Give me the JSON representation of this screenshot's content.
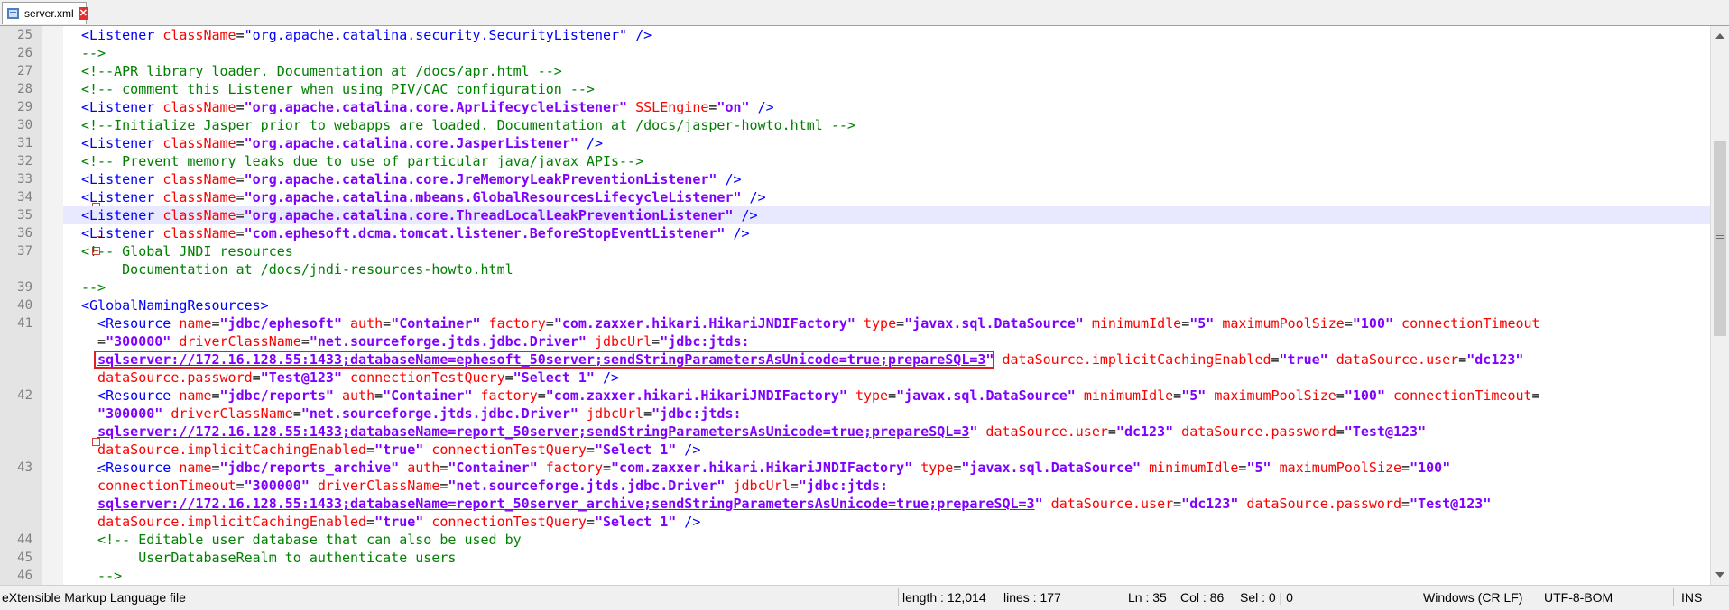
{
  "tab": {
    "label": "server.xml",
    "file_icon": "xml-file-icon",
    "close_icon": "close-icon"
  },
  "lines": [
    {
      "num": "25",
      "tokens": [
        [
          "t",
          "<Listener "
        ],
        [
          "a",
          "className"
        ],
        [
          "p",
          "="
        ],
        [
          "t",
          "\"org.apache.catalina.security.SecurityListener\" />"
        ]
      ]
    },
    {
      "num": "26",
      "tokens": [
        [
          "c",
          "-->"
        ]
      ]
    },
    {
      "num": "27",
      "tokens": [
        [
          "c",
          "<!--APR library loader. Documentation at /docs/apr.html -->"
        ]
      ]
    },
    {
      "num": "28",
      "tokens": [
        [
          "c",
          "<!-- comment this Listener when using PIV/CAC configuration -->"
        ]
      ]
    },
    {
      "num": "29",
      "tokens": [
        [
          "t",
          "<Listener "
        ],
        [
          "a",
          "className"
        ],
        [
          "p",
          "="
        ],
        [
          "v",
          "\"org.apache.catalina.core.AprLifecycleListener\""
        ],
        [
          "a",
          " SSLEngine"
        ],
        [
          "p",
          "="
        ],
        [
          "v",
          "\"on\""
        ],
        [
          "t",
          " />"
        ]
      ]
    },
    {
      "num": "30",
      "tokens": [
        [
          "c",
          "<!--Initialize Jasper prior to webapps are loaded. Documentation at /docs/jasper-howto.html -->"
        ]
      ]
    },
    {
      "num": "31",
      "tokens": [
        [
          "t",
          "<Listener "
        ],
        [
          "a",
          "className"
        ],
        [
          "p",
          "="
        ],
        [
          "v",
          "\"org.apache.catalina.core.JasperListener\""
        ],
        [
          "t",
          " />"
        ]
      ]
    },
    {
      "num": "32",
      "tokens": [
        [
          "c",
          "<!-- Prevent memory leaks due to use of particular java/javax APIs-->"
        ]
      ]
    },
    {
      "num": "33",
      "tokens": [
        [
          "t",
          "<Listener "
        ],
        [
          "a",
          "className"
        ],
        [
          "p",
          "="
        ],
        [
          "v",
          "\"org.apache.catalina.core.JreMemoryLeakPreventionListener\""
        ],
        [
          "t",
          " />"
        ]
      ]
    },
    {
      "num": "34",
      "tokens": [
        [
          "t",
          "<Listener "
        ],
        [
          "a",
          "className"
        ],
        [
          "p",
          "="
        ],
        [
          "v",
          "\"org.apache.catalina.mbeans.GlobalResourcesLifecycleListener\""
        ],
        [
          "t",
          " />"
        ]
      ]
    },
    {
      "num": "35",
      "current": true,
      "tokens": [
        [
          "t",
          "<Listener "
        ],
        [
          "a",
          "className"
        ],
        [
          "p",
          "="
        ],
        [
          "v",
          "\"org.apache.catalina.core.ThreadLocalLeakPreventionListener\""
        ],
        [
          "t",
          " />"
        ]
      ]
    },
    {
      "num": "36",
      "tokens": [
        [
          "t",
          "<Listener "
        ],
        [
          "a",
          "className"
        ],
        [
          "p",
          "="
        ],
        [
          "v",
          "\"com.ephesoft.dcma.tomcat.listener.BeforeStopEventListener\""
        ],
        [
          "t",
          " />"
        ]
      ]
    },
    {
      "num": "37",
      "tokens": [
        [
          "c",
          "<!-- Global JNDI resources"
        ]
      ]
    },
    {
      "num": "",
      "tokens": [
        [
          "c",
          "     Documentation at /docs/jndi-resources-howto.html"
        ]
      ]
    },
    {
      "num": "39",
      "tokens": [
        [
          "c",
          "-->"
        ]
      ]
    },
    {
      "num": "40",
      "tokens": [
        [
          "t",
          "<GlobalNamingResources>"
        ]
      ]
    },
    {
      "num": "41",
      "tokens": [
        [
          "t",
          "  <Resource "
        ],
        [
          "a",
          "name"
        ],
        [
          "p",
          "="
        ],
        [
          "v",
          "\"jdbc/ephesoft\""
        ],
        [
          "a",
          " auth"
        ],
        [
          "p",
          "="
        ],
        [
          "v",
          "\"Container\""
        ],
        [
          "a",
          " factory"
        ],
        [
          "p",
          "="
        ],
        [
          "v",
          "\"com.zaxxer.hikari.HikariJNDIFactory\""
        ],
        [
          "a",
          " type"
        ],
        [
          "p",
          "="
        ],
        [
          "v",
          "\"javax.sql.DataSource\""
        ],
        [
          "a",
          " minimumIdle"
        ],
        [
          "p",
          "="
        ],
        [
          "v",
          "\"5\""
        ],
        [
          "a",
          " maximumPoolSize"
        ],
        [
          "p",
          "="
        ],
        [
          "v",
          "\"100\""
        ],
        [
          "a",
          " connectionTimeout"
        ]
      ]
    },
    {
      "num": "",
      "tokens": [
        [
          "p",
          "  ="
        ],
        [
          "v",
          "\"300000\""
        ],
        [
          "a",
          " driverClassName"
        ],
        [
          "p",
          "="
        ],
        [
          "v",
          "\"net.sourceforge.jtds.jdbc.Driver\""
        ],
        [
          "a",
          " jdbcUrl"
        ],
        [
          "p",
          "="
        ],
        [
          "v",
          "\"jdbc:jtds:"
        ]
      ]
    },
    {
      "num": "",
      "boxed": true,
      "tokens": [
        [
          "p",
          "  "
        ],
        [
          "u",
          "sqlserver://172.16.128.55:1433;databaseName=ephesoft_50server;sendStringParametersAsUnicode=true;prepareSQL=3"
        ],
        [
          "v",
          "\""
        ],
        [
          "a",
          " dataSource.implicitCachingEnabled"
        ],
        [
          "p",
          "="
        ],
        [
          "v",
          "\"true\""
        ],
        [
          "a",
          " dataSource.user"
        ],
        [
          "p",
          "="
        ],
        [
          "v",
          "\"dc123\""
        ]
      ]
    },
    {
      "num": "",
      "tokens": [
        [
          "a",
          "  dataSource.password"
        ],
        [
          "p",
          "="
        ],
        [
          "v",
          "\"Test@123\""
        ],
        [
          "a",
          " connectionTestQuery"
        ],
        [
          "p",
          "="
        ],
        [
          "v",
          "\"Select 1\""
        ],
        [
          "t",
          " />"
        ]
      ]
    },
    {
      "num": "42",
      "tokens": [
        [
          "t",
          "  <Resource "
        ],
        [
          "a",
          "name"
        ],
        [
          "p",
          "="
        ],
        [
          "v",
          "\"jdbc/reports\""
        ],
        [
          "a",
          " auth"
        ],
        [
          "p",
          "="
        ],
        [
          "v",
          "\"Container\""
        ],
        [
          "a",
          " factory"
        ],
        [
          "p",
          "="
        ],
        [
          "v",
          "\"com.zaxxer.hikari.HikariJNDIFactory\""
        ],
        [
          "a",
          " type"
        ],
        [
          "p",
          "="
        ],
        [
          "v",
          "\"javax.sql.DataSource\""
        ],
        [
          "a",
          " minimumIdle"
        ],
        [
          "p",
          "="
        ],
        [
          "v",
          "\"5\""
        ],
        [
          "a",
          " maximumPoolSize"
        ],
        [
          "p",
          "="
        ],
        [
          "v",
          "\"100\""
        ],
        [
          "a",
          " connectionTimeout"
        ],
        [
          "p",
          "="
        ]
      ]
    },
    {
      "num": "",
      "tokens": [
        [
          "v",
          "  \"300000\""
        ],
        [
          "a",
          " driverClassName"
        ],
        [
          "p",
          "="
        ],
        [
          "v",
          "\"net.sourceforge.jtds.jdbc.Driver\""
        ],
        [
          "a",
          " jdbcUrl"
        ],
        [
          "p",
          "="
        ],
        [
          "v",
          "\"jdbc:jtds:"
        ]
      ]
    },
    {
      "num": "",
      "tokens": [
        [
          "p",
          "  "
        ],
        [
          "u",
          "sqlserver://172.16.128.55:1433;databaseName=report_50server;sendStringParametersAsUnicode=true;prepareSQL=3"
        ],
        [
          "v",
          "\""
        ],
        [
          "a",
          " dataSource.user"
        ],
        [
          "p",
          "="
        ],
        [
          "v",
          "\"dc123\""
        ],
        [
          "a",
          " dataSource.password"
        ],
        [
          "p",
          "="
        ],
        [
          "v",
          "\"Test@123\""
        ]
      ]
    },
    {
      "num": "",
      "tokens": [
        [
          "a",
          "  dataSource.implicitCachingEnabled"
        ],
        [
          "p",
          "="
        ],
        [
          "v",
          "\"true\""
        ],
        [
          "a",
          " connectionTestQuery"
        ],
        [
          "p",
          "="
        ],
        [
          "v",
          "\"Select 1\""
        ],
        [
          "t",
          " />"
        ]
      ]
    },
    {
      "num": "43",
      "tokens": [
        [
          "t",
          "  <Resource "
        ],
        [
          "a",
          "name"
        ],
        [
          "p",
          "="
        ],
        [
          "v",
          "\"jdbc/reports_archive\""
        ],
        [
          "a",
          " auth"
        ],
        [
          "p",
          "="
        ],
        [
          "v",
          "\"Container\""
        ],
        [
          "a",
          " factory"
        ],
        [
          "p",
          "="
        ],
        [
          "v",
          "\"com.zaxxer.hikari.HikariJNDIFactory\""
        ],
        [
          "a",
          " type"
        ],
        [
          "p",
          "="
        ],
        [
          "v",
          "\"javax.sql.DataSource\""
        ],
        [
          "a",
          " minimumIdle"
        ],
        [
          "p",
          "="
        ],
        [
          "v",
          "\"5\""
        ],
        [
          "a",
          " maximumPoolSize"
        ],
        [
          "p",
          "="
        ],
        [
          "v",
          "\"100\""
        ]
      ]
    },
    {
      "num": "",
      "tokens": [
        [
          "a",
          "  connectionTimeout"
        ],
        [
          "p",
          "="
        ],
        [
          "v",
          "\"300000\""
        ],
        [
          "a",
          " driverClassName"
        ],
        [
          "p",
          "="
        ],
        [
          "v",
          "\"net.sourceforge.jtds.jdbc.Driver\""
        ],
        [
          "a",
          " jdbcUrl"
        ],
        [
          "p",
          "="
        ],
        [
          "v",
          "\"jdbc:jtds:"
        ]
      ]
    },
    {
      "num": "",
      "tokens": [
        [
          "p",
          "  "
        ],
        [
          "u",
          "sqlserver://172.16.128.55:1433;databaseName=report_50server_archive;sendStringParametersAsUnicode=true;prepareSQL=3"
        ],
        [
          "v",
          "\""
        ],
        [
          "a",
          " dataSource.user"
        ],
        [
          "p",
          "="
        ],
        [
          "v",
          "\"dc123\""
        ],
        [
          "a",
          " dataSource.password"
        ],
        [
          "p",
          "="
        ],
        [
          "v",
          "\"Test@123\""
        ]
      ]
    },
    {
      "num": "",
      "tokens": [
        [
          "a",
          "  dataSource.implicitCachingEnabled"
        ],
        [
          "p",
          "="
        ],
        [
          "v",
          "\"true\""
        ],
        [
          "a",
          " connectionTestQuery"
        ],
        [
          "p",
          "="
        ],
        [
          "v",
          "\"Select 1\""
        ],
        [
          "t",
          " />"
        ]
      ]
    },
    {
      "num": "44",
      "tokens": [
        [
          "c",
          "  <!-- Editable user database that can also be used by"
        ]
      ]
    },
    {
      "num": "45",
      "tokens": [
        [
          "c",
          "       UserDatabaseRealm to authenticate users"
        ]
      ]
    },
    {
      "num": "46",
      "tokens": [
        [
          "c",
          "  -->"
        ]
      ]
    }
  ],
  "status": {
    "file_type": "eXtensible Markup Language file",
    "length": "length : 12,014",
    "lines": "lines : 177",
    "ln": "Ln : 35",
    "col": "Col : 86",
    "sel": "Sel : 0 | 0",
    "eol": "Windows (CR LF)",
    "encoding": "UTF-8-BOM",
    "mode": "INS"
  }
}
